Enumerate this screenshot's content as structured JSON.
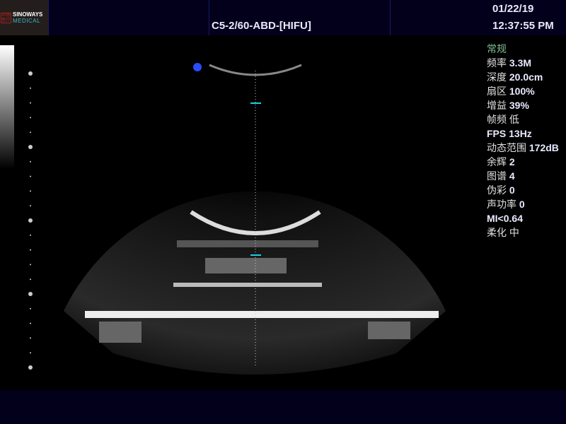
{
  "header": {
    "logo_brand": "SINOWAYS",
    "logo_sub": "MEDICAL",
    "logo_seal": "中惠医疗",
    "probe": "C5-2/60-ABD-[HIFU]",
    "date": "01/22/19",
    "time": "12:37:55 PM"
  },
  "params": [
    {
      "label": "常规",
      "value": ""
    },
    {
      "label": "频率",
      "value": "3.3M"
    },
    {
      "label": "深度",
      "value": "20.0cm"
    },
    {
      "label": "扇区",
      "value": "100%"
    },
    {
      "label": "增益",
      "value": "39%"
    },
    {
      "label": "帧频",
      "value": "低"
    },
    {
      "label": "",
      "value": "FPS 13Hz"
    },
    {
      "label": "动态范围",
      "value": "172dB"
    },
    {
      "label": "余辉",
      "value": "2"
    },
    {
      "label": "图谱",
      "value": "4"
    },
    {
      "label": "伪彩",
      "value": "0"
    },
    {
      "label": "声功率",
      "value": "0"
    },
    {
      "label": "",
      "value": "MI<0.64"
    },
    {
      "label": "柔化",
      "value": "中"
    }
  ],
  "colors": {
    "header_bg": "#02001a",
    "marker": "#2a4cff",
    "cursor": "#19d0e0"
  }
}
